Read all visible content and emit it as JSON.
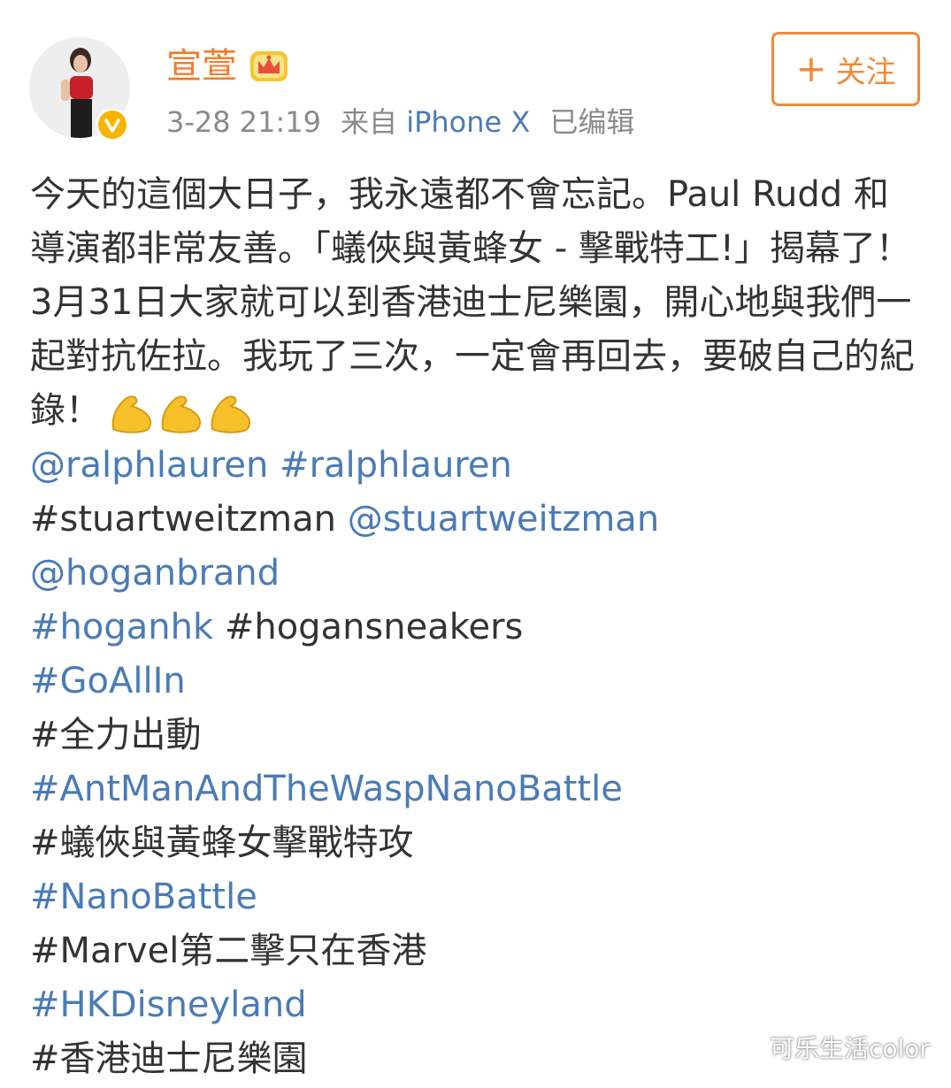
{
  "user": {
    "name": "宣萱",
    "timestamp": "3-28 21:19",
    "source_prefix": "来自",
    "device": "iPhone X",
    "edited": "已编辑",
    "follow_label": "关注"
  },
  "post": {
    "text": "今天的這個大日子，我永遠都不會忘記。Paul Rudd 和導演都非常友善。「蟻俠與黃蜂女 - 擊戰特工!」揭幕了！3月31日大家就可以到香港迪士尼樂園，開心地與我們一起對抗佐拉。我玩了三次，一定會再回去，要破自己的紀錄！",
    "emoji": "flexed-biceps-icon x3"
  },
  "tags": [
    [
      {
        "text": "@ralphlauren",
        "type": "link"
      },
      {
        "text": " ",
        "type": "plain"
      },
      {
        "text": "#ralphlauren",
        "type": "link"
      }
    ],
    [
      {
        "text": "#stuartweitzman",
        "type": "plain"
      },
      {
        "text": " ",
        "type": "plain"
      },
      {
        "text": "@stuartweitzman",
        "type": "link"
      }
    ],
    [
      {
        "text": "@hoganbrand",
        "type": "link"
      }
    ],
    [
      {
        "text": "#hoganhk",
        "type": "link"
      },
      {
        "text": " ",
        "type": "plain"
      },
      {
        "text": "#hogansneakers",
        "type": "plain"
      }
    ],
    [
      {
        "text": "#GoAllIn",
        "type": "link"
      }
    ],
    [
      {
        "text": "#全力出動",
        "type": "plain"
      }
    ],
    [
      {
        "text": "#AntManAndTheWaspNanoBattle",
        "type": "link"
      }
    ],
    [
      {
        "text": "#蟻俠與黃蜂女擊戰特攻",
        "type": "plain"
      }
    ],
    [
      {
        "text": "#NanoBattle",
        "type": "link"
      }
    ],
    [
      {
        "text": "#Marvel第二擊只在香港",
        "type": "plain"
      }
    ],
    [
      {
        "text": "#HKDisneyland",
        "type": "link"
      }
    ],
    [
      {
        "text": "#香港迪士尼樂園",
        "type": "plain"
      }
    ]
  ],
  "watermark": "可乐生活color",
  "colors": {
    "name": "#f27b2a",
    "link": "#4a7bb5",
    "text": "#333333",
    "meta": "#8a8a8a",
    "follow": "#f08a3a",
    "verified": "#f7b500"
  }
}
